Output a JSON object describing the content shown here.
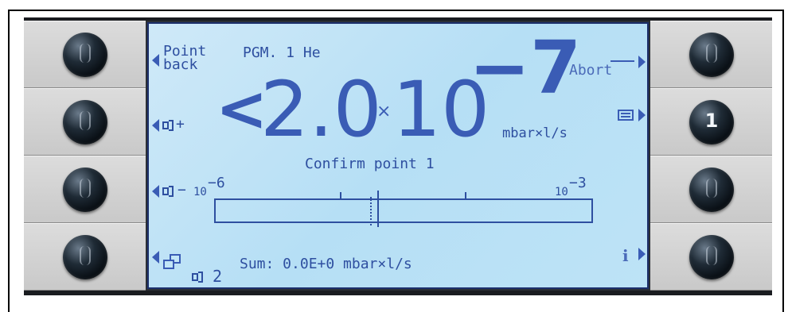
{
  "display": {
    "point_back_line1": "Point",
    "point_back_line2": "back",
    "program": "PGM. 1 He",
    "abort": "Abort",
    "reading_prefix": "<",
    "reading_mantissa": "2.0",
    "reading_times": "×",
    "reading_base": "10",
    "reading_exponent": "−7",
    "reading_unit": "mbar×l/s",
    "volume_up": "+",
    "volume_down": "−",
    "message": "Confirm point 1",
    "scale_min_base": "10",
    "scale_min_exp": "−6",
    "scale_max_base": "10",
    "scale_max_exp": "−3",
    "sum_label": "Sum: 0.0E+0 mbar×l/s",
    "volume_level": "2",
    "info_icon_glyph": "i",
    "bar_marker_fraction": 0.43
  },
  "keys": {
    "right_2_label": "1"
  },
  "colors": {
    "screen_text": "#2e4fa0",
    "screen_bg": "#bde3f6",
    "frame": "#1c2f6b"
  },
  "icons": [
    "list-icon",
    "speaker-icon",
    "windows-icon",
    "info-icon",
    "arrow-icon"
  ]
}
